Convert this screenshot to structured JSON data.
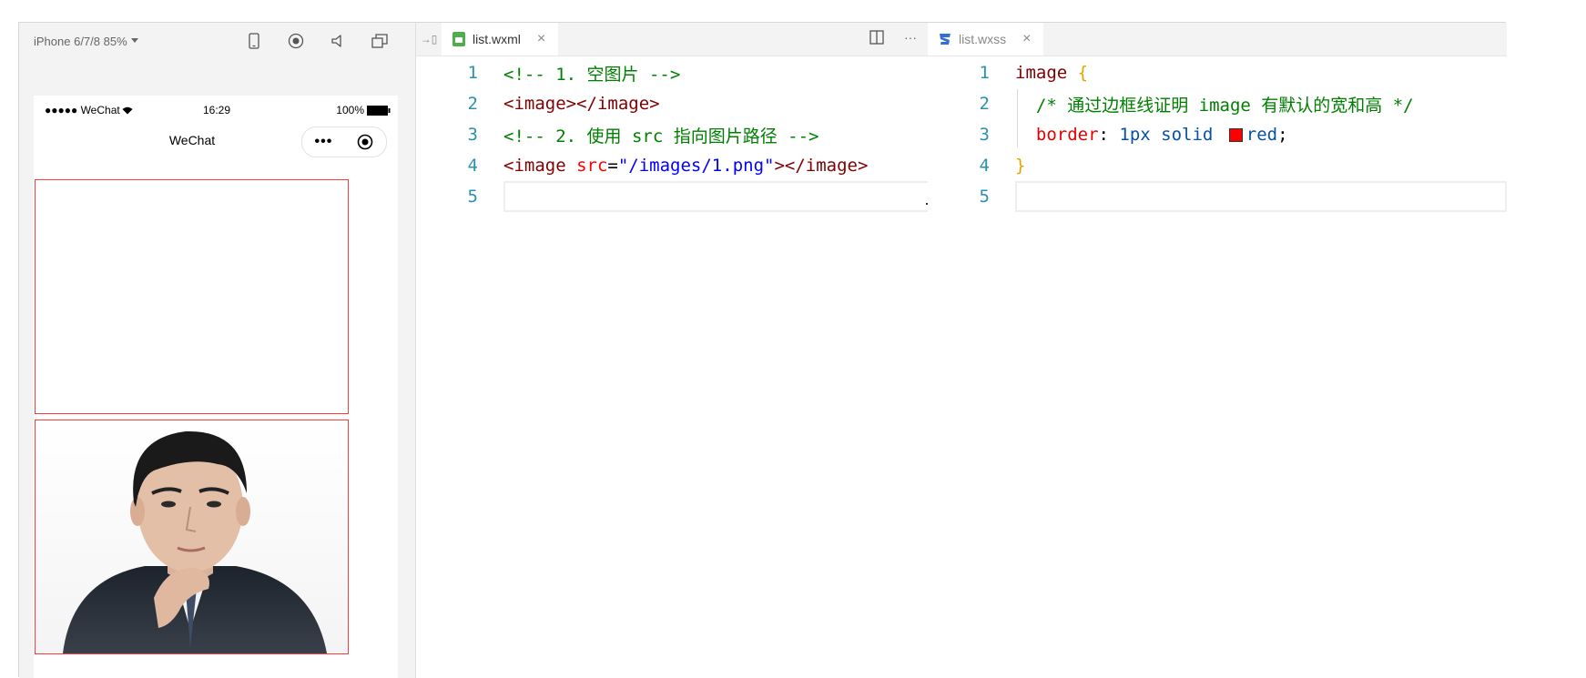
{
  "simulator": {
    "device_label": "iPhone 6/7/8 85%",
    "toolbar_icons": [
      "phone-icon",
      "record-icon",
      "volume-icon",
      "window-icon"
    ],
    "status": {
      "carrier": "●●●●● WeChat",
      "time": "16:29",
      "battery": "100%"
    },
    "nav_title": "WeChat",
    "capsule_more": "•••"
  },
  "editor_left": {
    "tab_label": "list.wxml",
    "tab_close": "×",
    "actions_more": "···",
    "lines": [
      {
        "num": "1",
        "tokens": [
          {
            "t": "<!-- 1. 空图片 -->",
            "c": "comment"
          }
        ]
      },
      {
        "num": "2",
        "tokens": [
          {
            "t": "<image></image>",
            "c": "tag"
          }
        ]
      },
      {
        "num": "3",
        "tokens": [
          {
            "t": "<!-- 2. 使用 src 指向图片路径 -->",
            "c": "comment"
          }
        ]
      },
      {
        "num": "4",
        "tokens": [
          {
            "t": "<image ",
            "c": "tag"
          },
          {
            "t": "src",
            "c": "attr"
          },
          {
            "t": "=",
            "c": "punc"
          },
          {
            "t": "\"/images/1.png\"",
            "c": "str"
          },
          {
            "t": "></image>",
            "c": "tag"
          }
        ]
      },
      {
        "num": "5",
        "tokens": []
      }
    ]
  },
  "editor_right": {
    "tab_label": "list.wxss",
    "tab_close": "×",
    "lines": [
      {
        "num": "1",
        "tokens": [
          {
            "t": "image ",
            "c": "sel"
          },
          {
            "t": "{",
            "c": "brace"
          }
        ]
      },
      {
        "num": "2",
        "tokens": [
          {
            "t": "  /* 通过边框线证明 image 有默认的宽和高 */",
            "c": "comment"
          }
        ]
      },
      {
        "num": "3",
        "tokens": [
          {
            "t": "  border",
            "c": "prop"
          },
          {
            "t": ": ",
            "c": "punc"
          },
          {
            "t": "1px solid ",
            "c": "val"
          },
          {
            "t": "red",
            "c": "val",
            "swatch": "#ff0000"
          },
          {
            "t": ";",
            "c": "punc"
          }
        ]
      },
      {
        "num": "4",
        "tokens": [
          {
            "t": "}",
            "c": "brace"
          }
        ]
      },
      {
        "num": "5",
        "tokens": []
      }
    ]
  },
  "colors": {
    "border_red": "#ff3b3b",
    "line_number": "#2b91af",
    "comment": "#008000"
  }
}
